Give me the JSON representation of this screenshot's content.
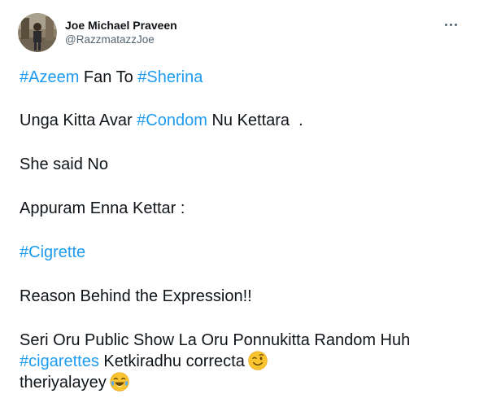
{
  "author": {
    "display_name": "Joe Michael Praveen",
    "handle": "@RazzmatazzJoe"
  },
  "tweet": {
    "line1_tag_a": "#Azeem",
    "line1_mid": " Fan To ",
    "line1_tag_b": "#Sherina",
    "line2_pre": "Unga Kitta Avar ",
    "line2_tag": "#Condom",
    "line2_post": " Nu Kettara  .",
    "line3": "She said No",
    "line4": "Appuram Enna Kettar :",
    "line5_tag": "#Cigrette",
    "line6": "Reason Behind the Expression!!",
    "line7": "Seri Oru Public Show La Oru Ponnukitta Random Huh",
    "line8_tag": "#cigarettes",
    "line8_post": " Ketkiradhu correcta",
    "line9": "theriyalayey"
  },
  "icons": {
    "more": "more-options-icon",
    "wink": "winking-face-emoji",
    "laugh": "face-with-tears-of-joy-emoji"
  },
  "colors": {
    "hashtag": "#1d9bf0",
    "text": "#0f1419",
    "secondary": "#536471"
  }
}
